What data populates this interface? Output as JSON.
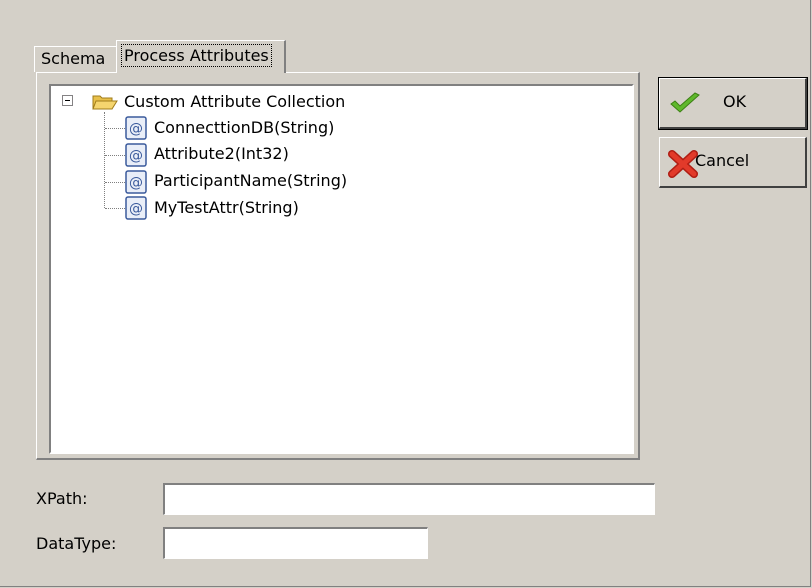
{
  "tabs": [
    {
      "label": "Schema",
      "active": false
    },
    {
      "label": "Process Attributes",
      "active": true
    }
  ],
  "tree": {
    "root": {
      "label": "Custom Attribute Collection",
      "icon": "open-folder-icon",
      "expanded": true
    },
    "items": [
      {
        "label": "ConnecttionDB(String)",
        "icon": "at-sign-attribute-icon"
      },
      {
        "label": "Attribute2(Int32)",
        "icon": "at-sign-attribute-icon"
      },
      {
        "label": "ParticipantName(String)",
        "icon": "at-sign-attribute-icon"
      },
      {
        "label": "MyTestAttr(String)",
        "icon": "at-sign-attribute-icon"
      }
    ]
  },
  "buttons": {
    "ok": {
      "label": "OK",
      "icon": "green-checkmark-icon"
    },
    "cancel": {
      "label": "Cancel",
      "icon": "red-x-icon"
    }
  },
  "fields": {
    "xpath": {
      "label": "XPath:",
      "value": ""
    },
    "datatype": {
      "label": "DataType:",
      "value": ""
    }
  },
  "colors": {
    "window_background": "#d4d0c8",
    "tree_background": "#ffffff",
    "ok_check_green": "#5fb82c",
    "cancel_x_red": "#e23a2a",
    "attribute_icon_blue": "#3a5a9c",
    "folder_yellow": "#f5d56e"
  }
}
